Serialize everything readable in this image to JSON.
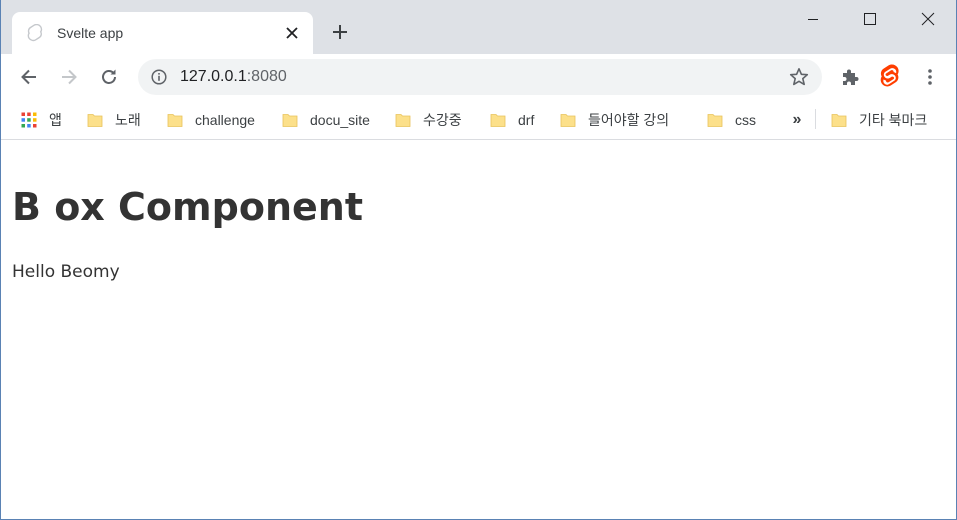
{
  "browser": {
    "tab": {
      "title": "Svelte app",
      "favicon": "svelte-icon"
    },
    "window_controls": [
      "minimize",
      "maximize",
      "close"
    ],
    "address_bar": {
      "host": "127.0.0.1",
      "port": ":8080"
    },
    "extensions": [
      "puzzle-icon",
      "svelte-icon"
    ]
  },
  "bookmarks": {
    "apps_label": "앱",
    "items": [
      {
        "label": "노래"
      },
      {
        "label": "challenge"
      },
      {
        "label": "docu_site"
      },
      {
        "label": "수강중"
      },
      {
        "label": "drf"
      },
      {
        "label": "들어야할 강의"
      },
      {
        "label": "css"
      }
    ],
    "more": "»",
    "other_label": "기타 북마크"
  },
  "page": {
    "heading": "B ox Component",
    "paragraph": "Hello Beomy"
  },
  "colors": {
    "tabstrip": "#dee1e6",
    "omnibox": "#f1f3f4",
    "folder": "#fce08a",
    "svelte": "#ff3e00",
    "text": "#333333"
  }
}
